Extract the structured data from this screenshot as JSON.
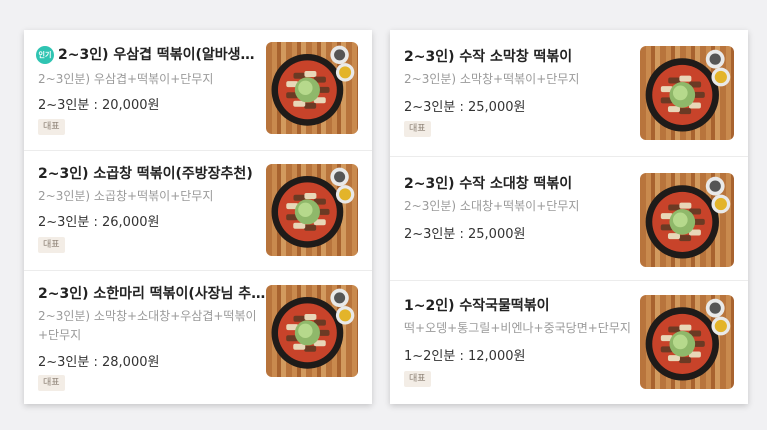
{
  "left_menu": [
    {
      "badge_hot": "인기",
      "title": "2~3인) 우삼겹 떡볶이(알바생…",
      "desc": "2~3인분) 우삼겹+떡볶이+단무지",
      "price": "2~3인분 : 20,000원",
      "tag": "대표"
    },
    {
      "title": "2~3인) 소곱창 떡볶이(주방장추천)",
      "desc": "2~3인분) 소곱창+떡볶이+단무지",
      "price": "2~3인분 : 26,000원",
      "tag": "대표"
    },
    {
      "title": "2~3인) 소한마리 떡볶이(사장님 추…",
      "desc_line1": "2~3인분) 소막창+소대창+우삼겹+떡볶이",
      "desc_line2": "+단무지",
      "price": "2~3인분 : 28,000원",
      "tag": "대표"
    }
  ],
  "right_menu": [
    {
      "title": "2~3인) 수작 소막창 떡볶이",
      "desc": "2~3인분) 소막창+떡볶이+단무지",
      "price": "2~3인분 : 25,000원",
      "tag": "대표"
    },
    {
      "title": "2~3인)  수작 소대창 떡볶이",
      "desc": "2~3인분) 소대창+떡볶이+단무지",
      "price": "2~3인분 : 25,000원"
    },
    {
      "title": "1~2인) 수작국물떡볶이",
      "desc": "떡+오뎅+통그릴+비엔나+중국당면+단무지",
      "price": "1~2인분 : 12,000원",
      "tag": "대표"
    }
  ],
  "colors": {
    "hot_badge": "#2fc4b2",
    "tag_bg": "#f3ede6"
  },
  "icons": {
    "thumbnail": "tteokbokki-pan-photo"
  }
}
